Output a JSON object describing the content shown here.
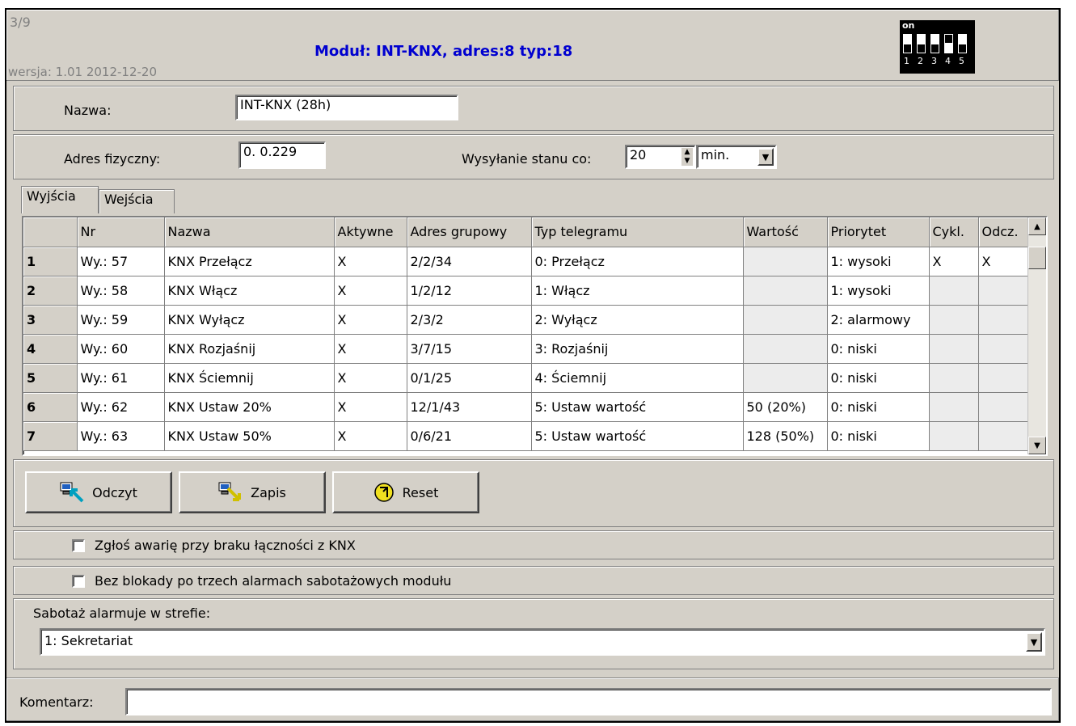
{
  "header": {
    "index": "3/9",
    "version": "wersja: 1.01 2012-12-20",
    "title": "Moduł: INT-KNX, adres:8 typ:18",
    "dip": {
      "on_label": "on",
      "numbers": [
        "1",
        "2",
        "3",
        "4",
        "5"
      ]
    }
  },
  "name_label": "Nazwa:",
  "name_value": "INT-KNX  (28h)",
  "physical_address_label": "Adres fizyczny:",
  "physical_address_value": "0. 0.229",
  "status_label": "Wysyłanie stanu co:",
  "status_value": "20",
  "status_unit": "min.",
  "tabs": [
    {
      "label": "Wyjścia"
    },
    {
      "label": "Wejścia"
    }
  ],
  "table": {
    "columns": [
      "",
      "Nr",
      "Nazwa",
      "Aktywne",
      "Adres grupowy",
      "Typ telegramu",
      "Wartość",
      "Priorytet",
      "Cykl.",
      "Odcz."
    ],
    "rows": [
      [
        "1",
        "Wy.: 57",
        "KNX Przełącz",
        "X",
        "2/2/34",
        "0: Przełącz",
        "",
        "1: wysoki",
        "X",
        "X"
      ],
      [
        "2",
        "Wy.: 58",
        "KNX Włącz",
        "X",
        "1/2/12",
        "1: Włącz",
        "",
        "1: wysoki",
        "",
        ""
      ],
      [
        "3",
        "Wy.: 59",
        "KNX Wyłącz",
        "X",
        "2/3/2",
        "2: Wyłącz",
        "",
        "2: alarmowy",
        "",
        ""
      ],
      [
        "4",
        "Wy.: 60",
        "KNX Rozjaśnij",
        "X",
        "3/7/15",
        "3: Rozjaśnij",
        "",
        "0: niski",
        "",
        ""
      ],
      [
        "5",
        "Wy.: 61",
        "KNX Ściemnij",
        "X",
        "0/1/25",
        "4: Ściemnij",
        "",
        "0: niski",
        "",
        ""
      ],
      [
        "6",
        "Wy.: 62",
        "KNX Ustaw 20%",
        "X",
        "12/1/43",
        "5: Ustaw wartość",
        "50 (20%)",
        "0: niski",
        "",
        ""
      ],
      [
        "7",
        "Wy.: 63",
        "KNX Ustaw 50%",
        "X",
        "0/6/21",
        "5: Ustaw wartość",
        "128 (50%)",
        "0: niski",
        "",
        ""
      ]
    ]
  },
  "buttons": {
    "read": "Odczyt",
    "write": "Zapis",
    "reset": "Reset"
  },
  "checkbox1": "Zgłoś awarię przy braku łączności z KNX",
  "checkbox2": "Bez blokady po trzech alarmach sabotażowych modułu",
  "tamper_label": "Sabotaż alarmuje w strefie:",
  "tamper_value": "1: Sekretariat",
  "comment_label": "Komentarz:",
  "comment_value": ""
}
